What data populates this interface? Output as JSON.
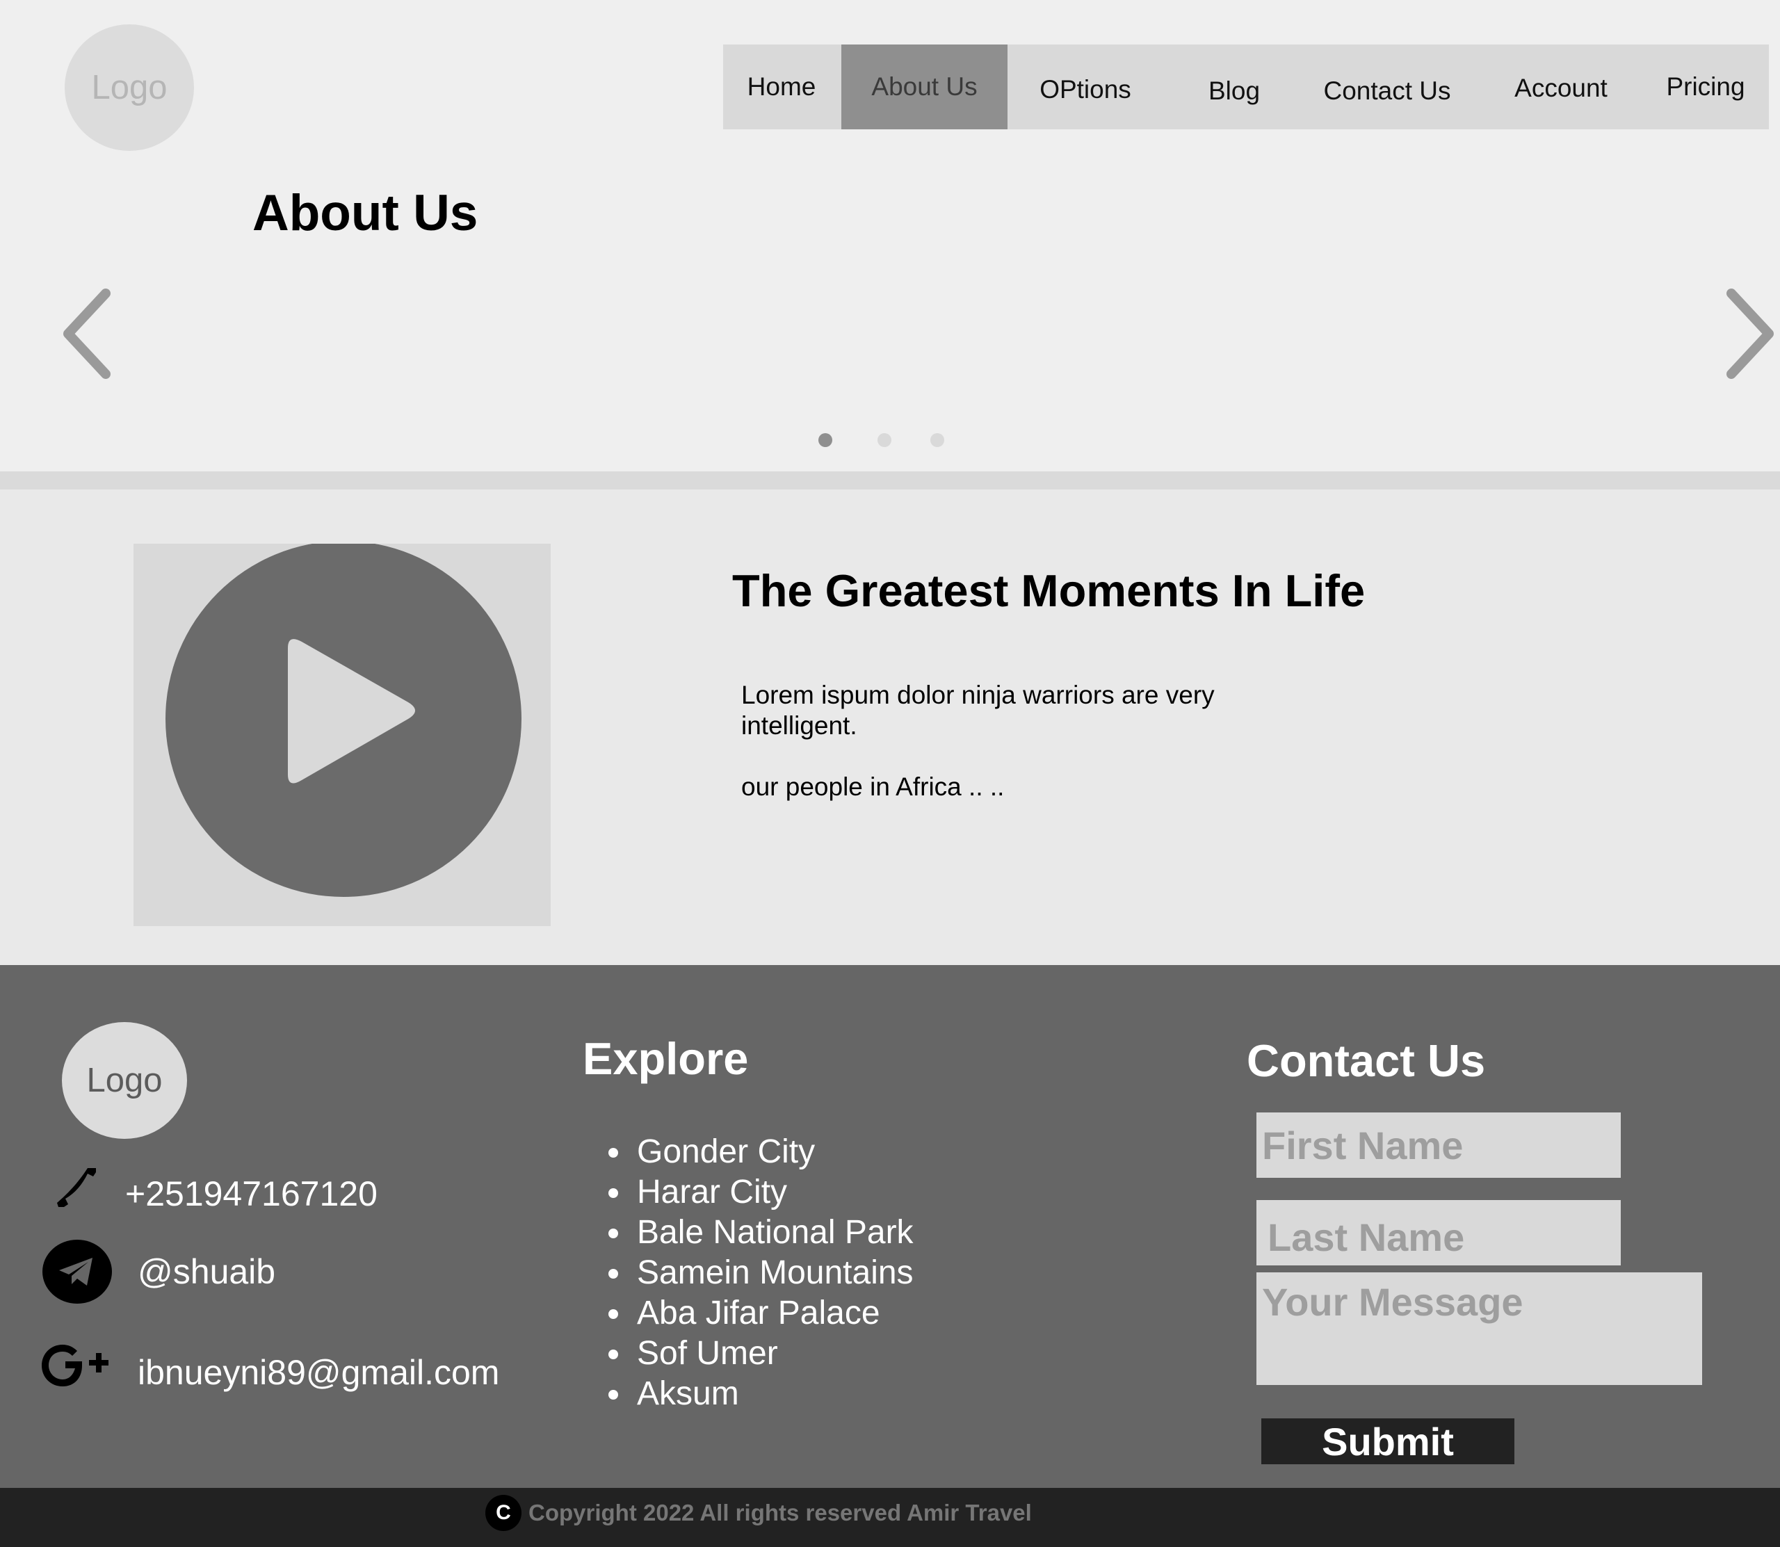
{
  "header": {
    "logo": "Logo",
    "nav": [
      {
        "label": "Home",
        "active": false
      },
      {
        "label": "About Us",
        "active": true
      },
      {
        "label": "OPtions",
        "active": false
      },
      {
        "label": "Blog",
        "active": false
      },
      {
        "label": "Contact Us",
        "active": false
      },
      {
        "label": "Account",
        "active": false
      },
      {
        "label": "Pricing",
        "active": false
      }
    ]
  },
  "hero": {
    "title": "About Us",
    "slide_count": 3,
    "active_slide": 1
  },
  "feature": {
    "title": "The Greatest Moments In Life",
    "paragraph1": "Lorem ispum dolor ninja warriors are very intelligent.",
    "paragraph2": "our people in Africa .. .."
  },
  "footer": {
    "logo": "Logo",
    "phone": "+251947167120",
    "telegram": "@shuaib",
    "email": "ibnueyni89@gmail.com",
    "explore_heading": "Explore",
    "explore_items": [
      "Gonder City",
      "Harar City",
      "Bale National Park",
      "Samein Mountains",
      "Aba Jifar Palace",
      "Sof Umer",
      "Aksum"
    ],
    "contact_heading": "Contact Us",
    "first_name_placeholder": "First Name",
    "last_name_placeholder": "Last Name",
    "message_placeholder": "Your Message",
    "submit_label": "Submit"
  },
  "copyright": {
    "symbol": "C",
    "text": "Copyright 2022 All rights reserved Amir Travel"
  }
}
